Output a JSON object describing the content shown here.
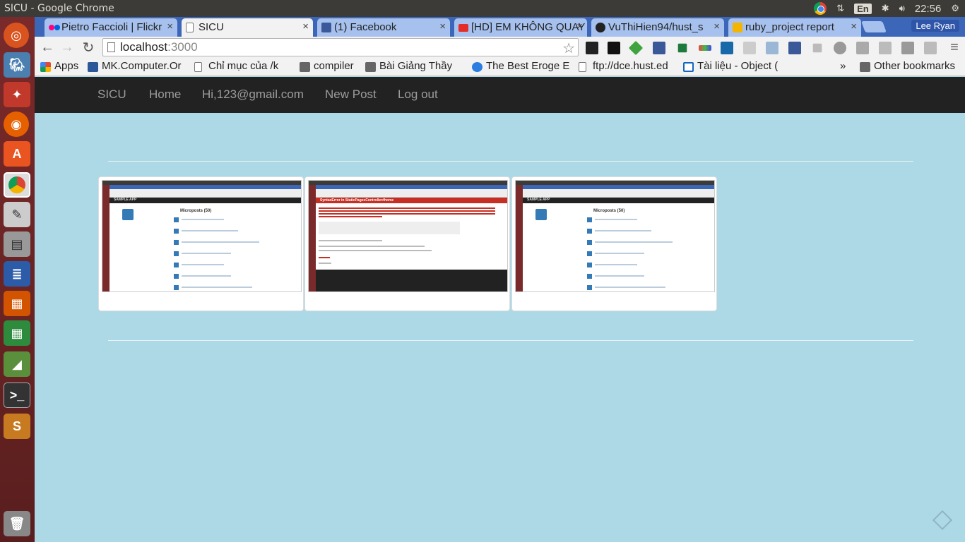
{
  "os": {
    "window_title": "SICU - Google Chrome",
    "keyboard_layout": "En",
    "clock": "22:56",
    "user": "Lee Ryan"
  },
  "browser": {
    "tabs": [
      {
        "title": "Pietro Faccioli | Flickr",
        "favicon_color": "#ff0084"
      },
      {
        "title": "SICU",
        "favicon_color": "#ffffff",
        "active": true
      },
      {
        "title": "(1) Facebook",
        "favicon_color": "#3b5998"
      },
      {
        "title": "[HD] EM KHÔNG QUAY",
        "favicon_color": "#e52d27"
      },
      {
        "title": "VuThiHien94/hust_s",
        "favicon_color": "#222222"
      },
      {
        "title": "ruby_project report",
        "favicon_color": "#f4b400"
      }
    ],
    "close_glyph": "×",
    "address": {
      "host": "localhost",
      "port": ":3000"
    },
    "bookmarks": [
      {
        "label": "Apps",
        "icon_color": "#dd4b39"
      },
      {
        "label": "MK.Computer.Or",
        "icon_color": "#2b579a"
      },
      {
        "label": "Chỉ mục của /k",
        "icon_color": "#777777"
      },
      {
        "label": "compiler",
        "icon_color": "#777777"
      },
      {
        "label": "Bài Giảng Thầy",
        "icon_color": "#777777"
      },
      {
        "label": "The Best Eroge E",
        "icon_color": "#2a7de1"
      },
      {
        "label": "ftp://dce.hust.ed",
        "icon_color": "#777777"
      },
      {
        "label": "Tài liệu - Object (",
        "icon_color": "#1565c0"
      }
    ],
    "bookmarks_overflow": "»",
    "other_bookmarks": "Other bookmarks"
  },
  "site": {
    "brand": "SICU",
    "nav": {
      "home": "Home",
      "user_email": "Hi,123@gmail.com",
      "new_post": "New Post",
      "logout": "Log out"
    },
    "thumbnails": [
      {
        "kind": "app",
        "app_title": "SAMPLE APP",
        "section": "Microposts (50)"
      },
      {
        "kind": "error",
        "error_title": "SyntaxError in StaticPagesController#home"
      },
      {
        "kind": "app",
        "app_title": "SAMPLE APP",
        "section": "Microposts (50)"
      }
    ]
  }
}
